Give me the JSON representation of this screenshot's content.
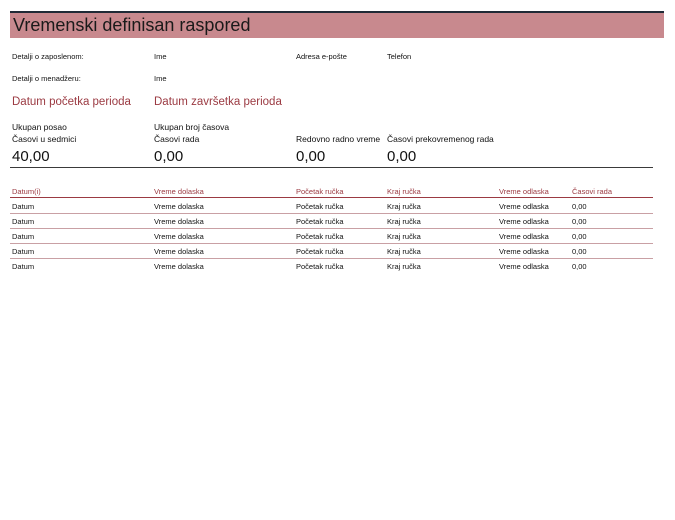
{
  "title": "Vremenski definisan raspored",
  "employee": {
    "label": "Detalji o zaposlenom:",
    "name": "Ime",
    "email": "Adresa e-pošte",
    "phone": "Telefon"
  },
  "manager": {
    "label": "Detalji o menadžeru:",
    "name": "Ime"
  },
  "period": {
    "start": "Datum početka perioda",
    "end": "Datum završetka perioda"
  },
  "totals": {
    "total_work_label": "Ukupan posao",
    "total_hours_label": "Ukupan broj časova",
    "hours_per_week_label": "Časovi u sedmici",
    "hours_per_week_value": "40,00",
    "work_hours_label": "Časovi rada",
    "work_hours_value": "0,00",
    "regular_label": "Redovno radno vreme",
    "regular_value": "0,00",
    "overtime_label": "Časovi prekovremenog rada",
    "overtime_value": "0,00"
  },
  "table": {
    "headers": [
      "Datum(i)",
      "Vreme dolaska",
      "Početak ručka",
      "Kraj ručka",
      "Vreme odlaska",
      "Časovi rada"
    ],
    "rows": [
      [
        "Datum",
        "Vreme dolaska",
        "Početak ručka",
        "Kraj ručka",
        "Vreme odlaska",
        "0,00"
      ],
      [
        "Datum",
        "Vreme dolaska",
        "Početak ručka",
        "Kraj ručka",
        "Vreme odlaska",
        "0,00"
      ],
      [
        "Datum",
        "Vreme dolaska",
        "Početak ručka",
        "Kraj ručka",
        "Vreme odlaska",
        "0,00"
      ],
      [
        "Datum",
        "Vreme dolaska",
        "Početak ručka",
        "Kraj ručka",
        "Vreme odlaska",
        "0,00"
      ],
      [
        "Datum",
        "Vreme dolaska",
        "Početak ručka",
        "Kraj ručka",
        "Vreme odlaska",
        "0,00"
      ]
    ]
  },
  "colors": {
    "banner": "#c8898e",
    "accent": "#9b3a42"
  }
}
